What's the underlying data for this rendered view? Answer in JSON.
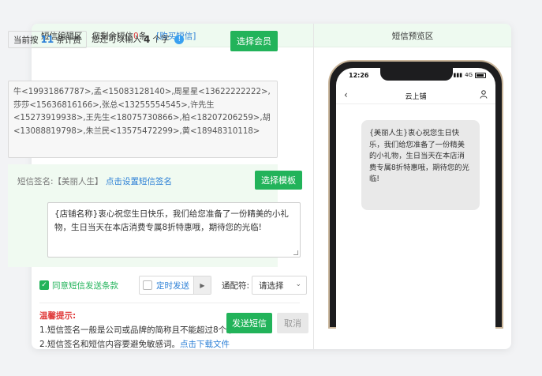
{
  "header": {
    "left_title": "短信编辑区",
    "remaining_prefix": "您剩余短信",
    "remaining_count": "0",
    "remaining_suffix": "条",
    "buy_link": "[购买短信]",
    "right_title": "短信预览区"
  },
  "editor": {
    "count_prefix": "当前按",
    "count_value": "11",
    "count_suffix": "条计费",
    "can_input_prefix": "您还可以输入",
    "can_input_value": "4",
    "can_input_suffix": "个字",
    "select_member_label": "选择会员",
    "recipients_text": "牛<19931867787>,孟<15083128140>,周星星<13622222222>,莎莎<15636816166>,张总<13255554545>,许先生<15273919938>,王先生<18075730866>,柏<18207206259>,胡<13088819798>,朱兰民<13575472299>,黄<18948310118>",
    "signature_label": "短信签名:【美丽人生】",
    "signature_link": "点击设置短信签名",
    "select_template_label": "选择模板",
    "message_text": "{店铺名称}衷心祝您生日快乐，我们给您准备了一份精美的小礼物，生日当天在本店消费专属8折特惠哦，期待您的光临!",
    "agree_label": "同意短信发送条款",
    "schedule_label": "定时发送",
    "wildcard_label": "通配符:",
    "wildcard_value": "请选择",
    "tips_title": "温馨提示:",
    "tip1": "1.短信签名一般是公司或品牌的简称且不能超过8个字,",
    "tip2_prefix": "2.短信签名和短信内容要避免敏感词。",
    "tip2_link": "点击下载文件",
    "send_label": "发送短信",
    "cancel_label": "取消"
  },
  "preview": {
    "status_time": "12:26",
    "status_net": "4G",
    "nav_title": "云上铺",
    "bubble_text": "{美丽人生}衷心祝您生日快乐，我们给您准备了一份精美的小礼物，生日当天在本店消费专属8折特惠哦，期待您的光临!"
  },
  "colors": {
    "accent_green": "#22b35a",
    "link_blue": "#2b7fd6",
    "alert_red": "#e03c3c"
  }
}
